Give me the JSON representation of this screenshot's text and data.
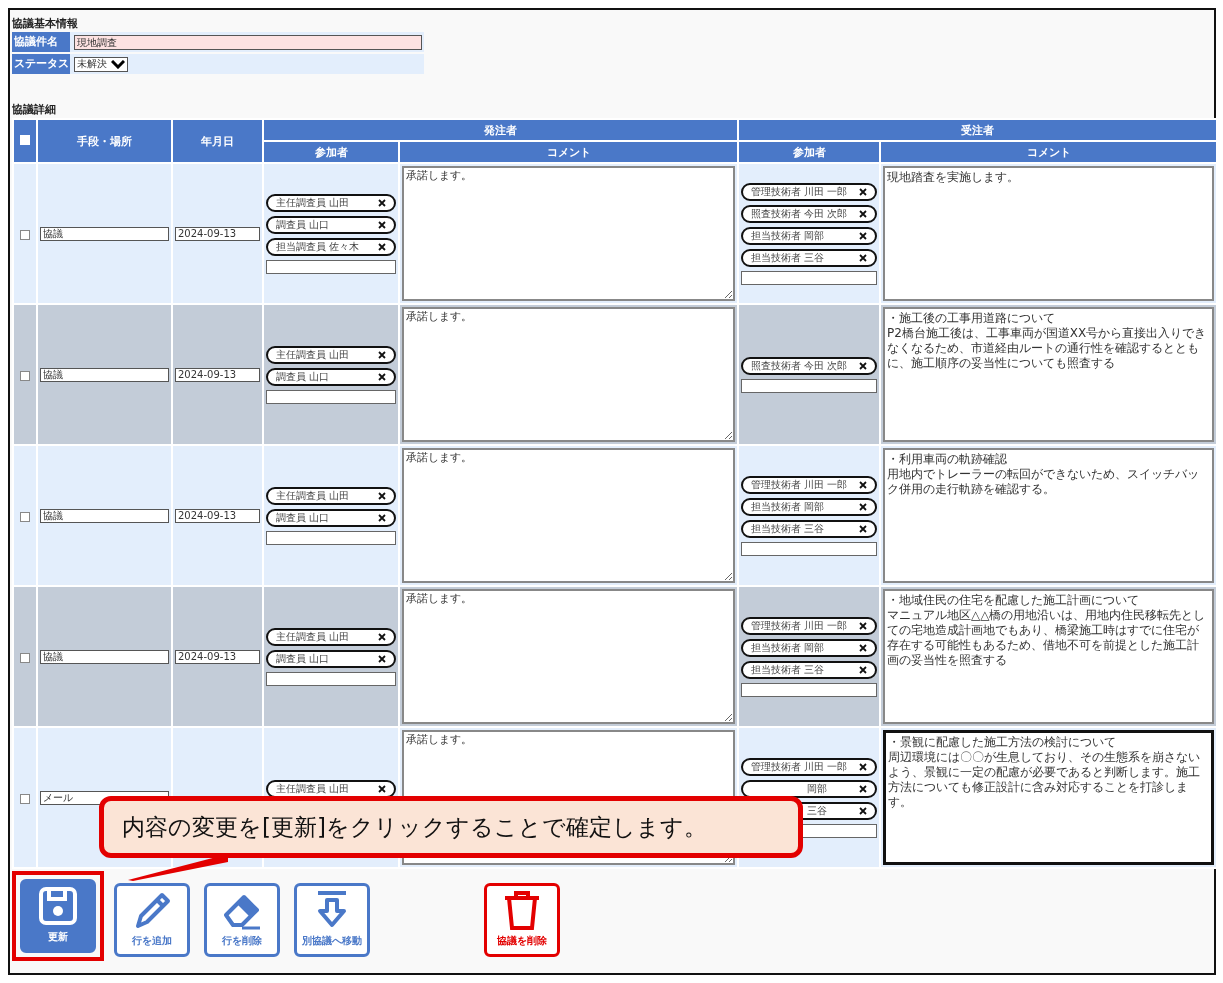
{
  "basic_info": {
    "title": "協議基本情報",
    "fields": [
      {
        "label": "協議件名",
        "kind": "text",
        "value": "現地調査"
      },
      {
        "label": "ステータス",
        "kind": "select",
        "value": "未解決"
      }
    ]
  },
  "details": {
    "title": "協議詳細",
    "header_checkbox": {
      "checked": false
    },
    "columns": {
      "method": "手段・場所",
      "date": "年月日",
      "orderer": {
        "label": "発注者",
        "participants": "参加者",
        "comment": "コメント"
      },
      "contractor": {
        "label": "受注者",
        "participants": "参加者",
        "comment": "コメント"
      }
    },
    "rows": [
      {
        "checked": false,
        "method": "協議",
        "date": "2024-09-13",
        "orderer": {
          "participants": [
            {
              "name": "主任調査員 山田",
              "covered": false
            },
            {
              "name": "調査員 山口",
              "covered": false
            },
            {
              "name": "担当調査員 佐々木",
              "covered": false
            }
          ],
          "comment": "承諾します。",
          "focused": false
        },
        "contractor": {
          "participants": [
            {
              "name": "管理技術者 川田 一郎",
              "covered": false
            },
            {
              "name": "照査技術者 今田 次郎",
              "covered": false
            },
            {
              "name": "担当技術者 岡部",
              "covered": false
            },
            {
              "name": "担当技術者 三谷",
              "covered": false
            }
          ],
          "comment": [
            "現地踏査を実施します。"
          ],
          "focused": false
        }
      },
      {
        "checked": false,
        "method": "協議",
        "date": "2024-09-13",
        "orderer": {
          "participants": [
            {
              "name": "主任調査員 山田",
              "covered": false
            },
            {
              "name": "調査員 山口",
              "covered": false
            }
          ],
          "comment": "承諾します。",
          "focused": false
        },
        "contractor": {
          "participants": [
            {
              "name": "照査技術者 今田 次郎",
              "covered": false
            }
          ],
          "comment": [
            "・施工後の工事用道路について",
            "P2橋台施工後は、工事車両が国道XX号から直接出入りできなくなるため、市道経由ルートの通行性を確認するとともに、施工順序の妥当性についても照査する"
          ],
          "focused": false
        }
      },
      {
        "checked": false,
        "method": "協議",
        "date": "2024-09-13",
        "orderer": {
          "participants": [
            {
              "name": "主任調査員 山田",
              "covered": false
            },
            {
              "name": "調査員 山口",
              "covered": false
            }
          ],
          "comment": "承諾します。",
          "focused": false
        },
        "contractor": {
          "participants": [
            {
              "name": "管理技術者 川田 一郎",
              "covered": false
            },
            {
              "name": "担当技術者 岡部",
              "covered": false
            },
            {
              "name": "担当技術者 三谷",
              "covered": false
            }
          ],
          "comment": [
            "・利用車両の軌跡確認",
            "用地内でトレーラーの転回ができないため、スイッチバック併用の走行軌跡を確認する。"
          ],
          "focused": false
        }
      },
      {
        "checked": false,
        "method": "協議",
        "date": "2024-09-13",
        "orderer": {
          "participants": [
            {
              "name": "主任調査員 山田",
              "covered": false
            },
            {
              "name": "調査員 山口",
              "covered": false
            }
          ],
          "comment": "承諾します。",
          "focused": false
        },
        "contractor": {
          "participants": [
            {
              "name": "管理技術者 川田 一郎",
              "covered": false
            },
            {
              "name": "担当技術者 岡部",
              "covered": false
            },
            {
              "name": "担当技術者 三谷",
              "covered": false
            }
          ],
          "comment": [
            "・地域住民の住宅を配慮した施工計画について",
            "マニュアル地区△△橋の用地沿いは、用地内住民移転先としての宅地造成計画地でもあり、橋梁施工時はすでに住宅が存在する可能性もあるため、借地不可を前提とした施工計画の妥当性を照査する"
          ],
          "focused": false
        }
      },
      {
        "checked": false,
        "method": "メール",
        "orderer": {
          "participants": [
            {
              "name": "主任調査員 山田",
              "covered": false
            }
          ],
          "input_hidden": true,
          "comment": "承諾します。",
          "focused": false
        },
        "contractor": {
          "participants": [
            {
              "name": "管理技術者 川田 一郎",
              "covered": false
            },
            {
              "name": "岡部",
              "covered": true
            },
            {
              "name": "三谷",
              "covered": true
            }
          ],
          "comment": [
            "・景観に配慮した施工方法の検討について",
            "周辺環境には〇〇が生息しており、その生態系を崩さないよう、景観に一定の配慮が必要であると判断します。施工方法についても修正設計に含み対応することを打診します。"
          ],
          "focused": true
        }
      }
    ]
  },
  "callout": {
    "text": "内容の変更を[更新]をクリックすることで確定します。"
  },
  "toolbar": [
    {
      "label": "更新",
      "kind": "save",
      "highlighted": true
    },
    {
      "label": "行を追加",
      "kind": "add",
      "highlighted": false
    },
    {
      "label": "行を削除",
      "kind": "erase",
      "highlighted": false
    },
    {
      "label": "別協議へ移動",
      "kind": "move",
      "highlighted": false
    },
    {
      "label": "協議を削除",
      "kind": "delete",
      "highlighted": false
    }
  ]
}
